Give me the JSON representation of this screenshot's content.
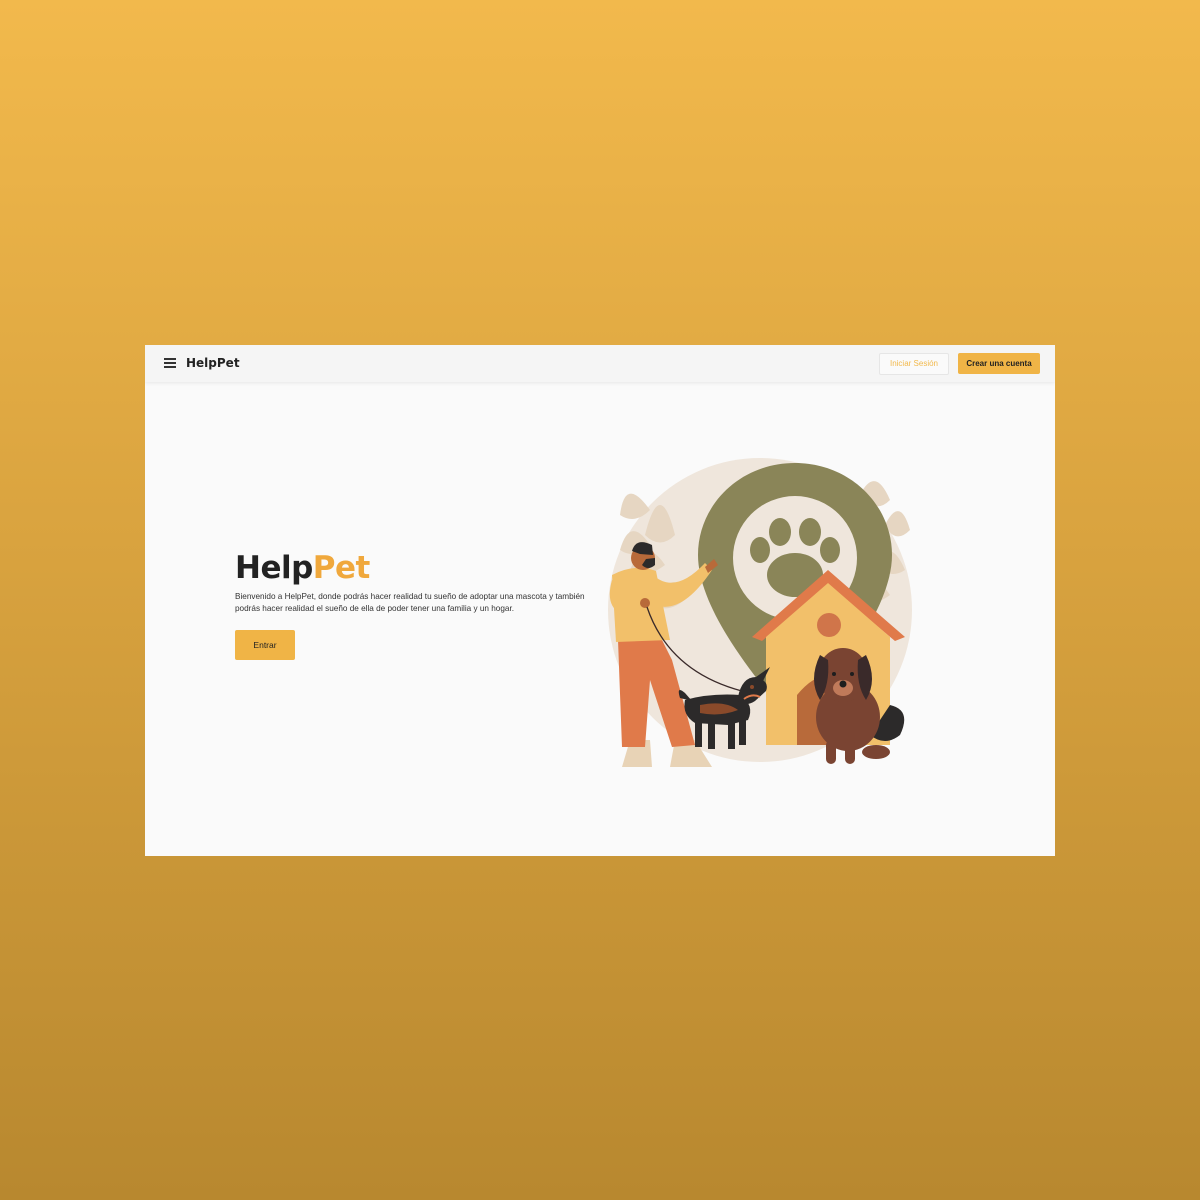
{
  "navbar": {
    "brand": "HelpPet",
    "login_label": "Iniciar Sesión",
    "signup_label": "Crear una cuenta"
  },
  "hero": {
    "title_part1": "Help",
    "title_part2": "Pet",
    "description": "Bienvenido a HelpPet, donde podrás hacer realidad tu sueño de adoptar una mascota y también podrás hacer realidad el sueño de ella de poder tener una familia y un hogar.",
    "enter_label": "Entrar"
  },
  "colors": {
    "accent": "#f0b446",
    "background_gradient_top": "#f2b94c",
    "background_gradient_bottom": "#b8882f",
    "olive": "#8a8558"
  },
  "icons": [
    "menu-icon",
    "paw-icon",
    "location-pin-icon"
  ]
}
